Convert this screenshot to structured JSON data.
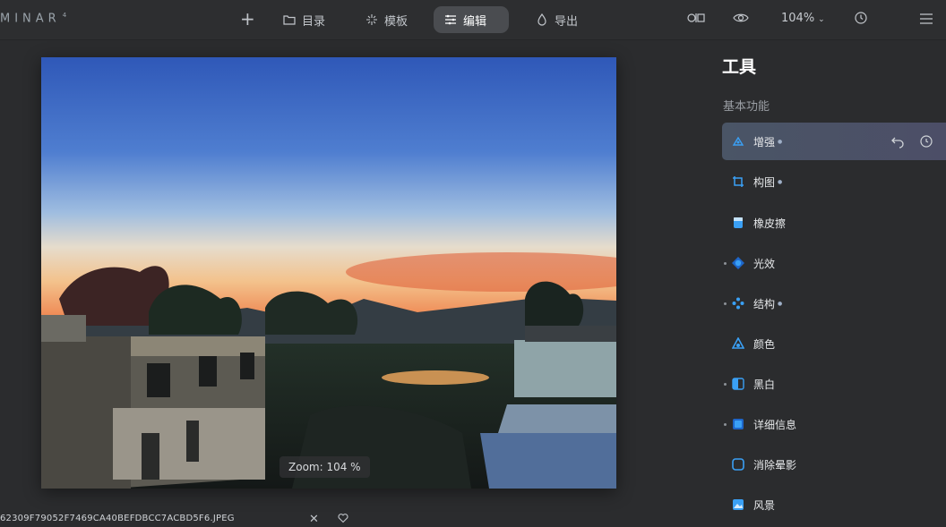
{
  "app": {
    "brand": "MINAR",
    "brand_sup": "4"
  },
  "toolbar": {
    "add_label": "+",
    "tabs": [
      {
        "label": "目录",
        "icon": "folder-icon"
      },
      {
        "label": "模板",
        "icon": "sparkle-icon"
      },
      {
        "label": "编辑",
        "icon": "sliders-icon",
        "active": true
      },
      {
        "label": "导出",
        "icon": "export-drop-icon"
      }
    ],
    "zoom": "104%",
    "compare_icon": "before-after-icon",
    "preview_icon": "eye-icon",
    "history_icon": "history-icon",
    "menu_icon": "more-icon"
  },
  "photo": {
    "zoom_label": "Zoom: 104 %"
  },
  "bottom": {
    "filename": "62309F79052F7469CA40BEFDBCC7ACBD5F6.JPEG"
  },
  "panel": {
    "title": "工具",
    "section": "基本功能",
    "tools": [
      {
        "label": "增强",
        "icon": "enhance-icon",
        "selected": true,
        "badge": "ai"
      },
      {
        "label": "构图",
        "icon": "crop-icon",
        "badge": "ai"
      },
      {
        "label": "橡皮擦",
        "icon": "eraser-icon"
      },
      {
        "label": "光效",
        "icon": "light-icon",
        "dot": true
      },
      {
        "label": "结构",
        "icon": "structure-icon",
        "dot": true,
        "badge": "ai"
      },
      {
        "label": "颜色",
        "icon": "color-icon"
      },
      {
        "label": "黑白",
        "icon": "bw-icon",
        "dot": true
      },
      {
        "label": "详细信息",
        "icon": "details-icon",
        "dot": true
      },
      {
        "label": "消除晕影",
        "icon": "vignette-icon"
      },
      {
        "label": "风景",
        "icon": "landscape-icon"
      }
    ]
  },
  "colors": {
    "accent": "#3aa0f5",
    "panel_bg": "#2b2c2e",
    "selected_bg": "#4a5566"
  }
}
